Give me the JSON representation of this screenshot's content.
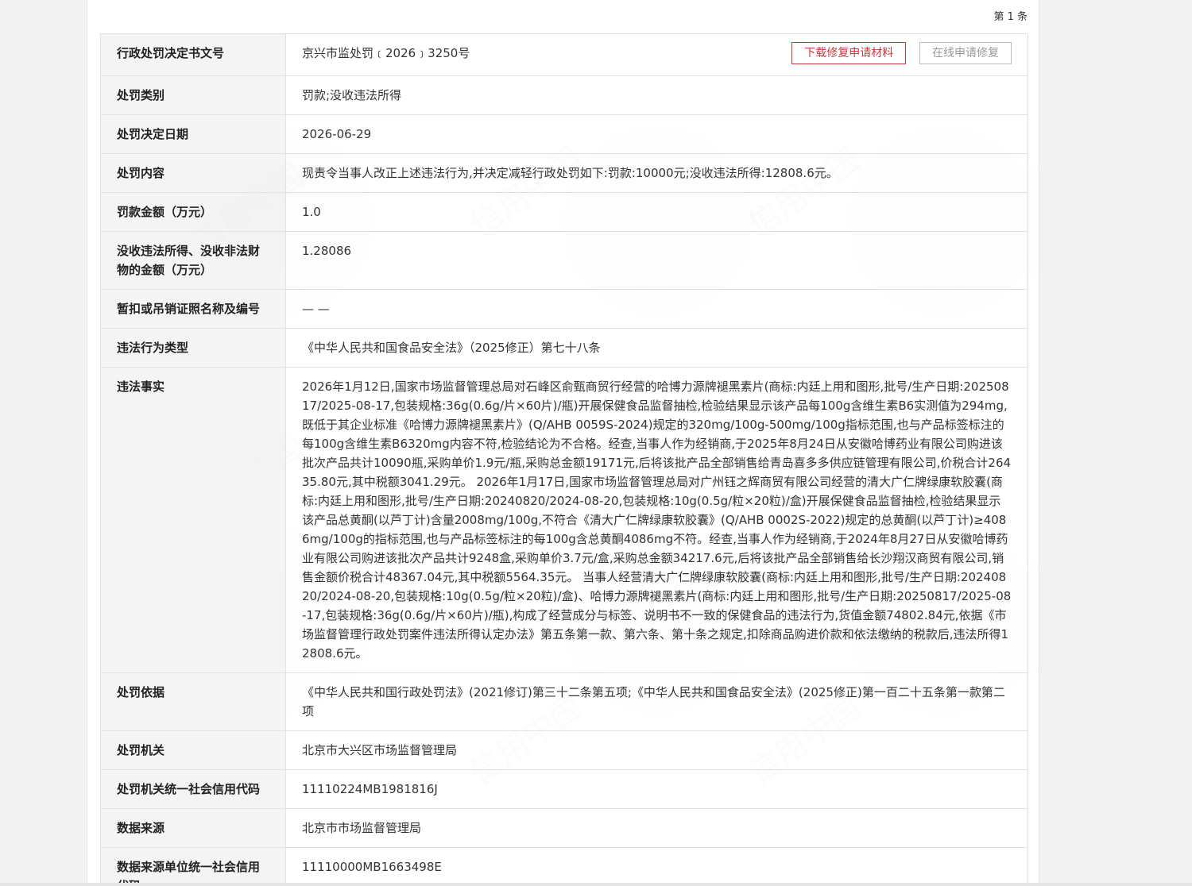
{
  "header": {
    "item_no": "第 1 条"
  },
  "buttons": {
    "download": "下载修复申请材料",
    "online": "在线申请修复"
  },
  "rows": [
    {
      "label": "行政处罚决定书文号",
      "value": "京兴市监处罚﹝2026﹞3250号"
    },
    {
      "label": "处罚类别",
      "value": "罚款;没收违法所得"
    },
    {
      "label": "处罚决定日期",
      "value": "2026-06-29"
    },
    {
      "label": "处罚内容",
      "value": "现责令当事人改正上述违法行为,并决定减轻行政处罚如下:罚款:10000元;没收违法所得:12808.6元。"
    },
    {
      "label": "罚款金额（万元）",
      "value": "1.0"
    },
    {
      "label": "没收违法所得、没收非法财物的金额（万元）",
      "value": "1.28086"
    },
    {
      "label": "暂扣或吊销证照名称及编号",
      "value": "— —"
    },
    {
      "label": "违法行为类型",
      "value": "《中华人民共和国食品安全法》（2025修正）第七十八条"
    },
    {
      "label": "违法事实",
      "value": "2026年1月12日,国家市场监督管理总局对石峰区俞甄商贸行经营的哈博力源牌褪黑素片(商标:内廷上用和图形,批号/生产日期:20250817/2025-08-17,包装规格:36g(0.6g/片×60片)/瓶)开展保健食品监督抽检,检验结果显示该产品每100g含维生素B6实测值为294mg,既低于其企业标准《哈博力源牌褪黑素片》(Q/AHB 0059S-2024)规定的320mg/100g-500mg/100g指标范围,也与产品标签标注的每100g含维生素B6320mg内容不符,检验结论为不合格。经查,当事人作为经销商,于2025年8月24日从安徽哈博药业有限公司购进该批次产品共计10090瓶,采购单价1.9元/瓶,采购总金额19171元,后将该批产品全部销售给青岛喜多多供应链管理有限公司,价税合计26435.80元,其中税额3041.29元。 2026年1月17日,国家市场监督管理总局对广州钰之辉商贸有限公司经营的清大广仁牌绿康软胶囊(商标:内廷上用和图形,批号/生产日期:20240820/2024-08-20,包装规格:10g(0.5g/粒×20粒)/盒)开展保健食品监督抽检,检验结果显示该产品总黄酮(以芦丁计)含量2008mg/100g,不符合《清大广仁牌绿康软胶囊》(Q/AHB 0002S-2022)规定的总黄酮(以芦丁计)≥4086mg/100g的指标范围,也与产品标签标注的每100g含总黄酮4086mg不符。经查,当事人作为经销商,于2024年8月27日从安徽哈博药业有限公司购进该批次产品共计9248盒,采购单价3.7元/盒,采购总金额34217.6元,后将该批产品全部销售给长沙翔汉商贸有限公司,销售金额价税合计48367.04元,其中税额5564.35元。 当事人经营清大广仁牌绿康软胶囊(商标:内廷上用和图形,批号/生产日期:20240820/2024-08-20,包装规格:10g(0.5g/粒×20粒)/盒)、哈博力源牌褪黑素片(商标:内廷上用和图形,批号/生产日期:20250817/2025-08-17,包装规格:36g(0.6g/片×60片)/瓶),构成了经营成分与标签、说明书不一致的保健食品的违法行为,货值金额74802.84元,依据《市场监督管理行政处罚案件违法所得认定办法》第五条第一款、第六条、第十条之规定,扣除商品购进价款和依法缴纳的税款后,违法所得12808.6元。"
    },
    {
      "label": "处罚依据",
      "value": "《中华人民共和国行政处罚法》(2021修订)第三十二条第五项;《中华人民共和国食品安全法》(2025修正)第一百二十五条第一款第二项"
    },
    {
      "label": "处罚机关",
      "value": "北京市大兴区市场监督管理局"
    },
    {
      "label": "处罚机关统一社会信用代码",
      "value": "11110224MB1981816J"
    },
    {
      "label": "数据来源",
      "value": "北京市市场监督管理局"
    },
    {
      "label": "数据来源单位统一社会信用代码",
      "value": "11110000MB1663498E"
    }
  ]
}
